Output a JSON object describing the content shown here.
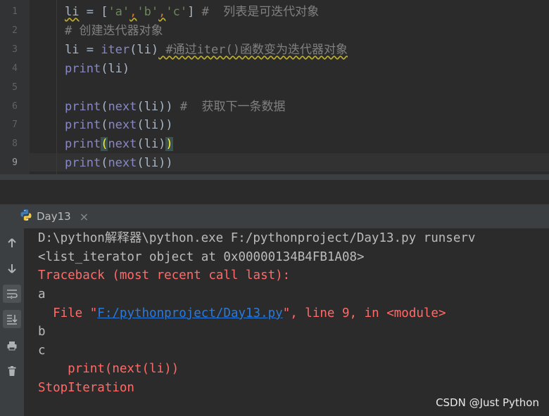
{
  "editor": {
    "line_numbers": [
      "1",
      "2",
      "3",
      "4",
      "5",
      "6",
      "7",
      "8",
      "9"
    ],
    "lines": {
      "l1": {
        "a": "li",
        "b": " = [",
        "s1": "'a'",
        "c1": ",",
        "s2": "'b'",
        "c2": ",",
        "s3": "'c'",
        "d": "]",
        "cmt": " #  列表是可迭代对象"
      },
      "l2": {
        "cmt": "# 创建迭代器对象"
      },
      "l3": {
        "a": "li = ",
        "fn": "iter",
        "b": "(li)",
        "cmt": " #通过iter()函数变为迭代器对象"
      },
      "l4": {
        "fn": "print",
        "b": "(li)"
      },
      "l6": {
        "fn": "print",
        "a": "(",
        "fn2": "next",
        "b": "(li))",
        "cmt": " #  获取下一条数据"
      },
      "l7": {
        "fn": "print",
        "a": "(",
        "fn2": "next",
        "b": "(li))"
      },
      "l8": {
        "fn": "print",
        "a": "(",
        "fn2": "next",
        "b": "(li)",
        "c": ")"
      },
      "l9": {
        "fn": "print",
        "a": "(",
        "fn2": "next",
        "b": "(li))"
      }
    }
  },
  "run_panel": {
    "tab_label": "Day13",
    "tab_close": "×"
  },
  "console": {
    "cmd": "D:\\python解释器\\python.exe F:/pythonproject/Day13.py runserv",
    "out1": "<list_iterator object at 0x00000134B4FB1A08>",
    "traceback": "Traceback (most recent call last):",
    "a": "a",
    "file_prefix": "  File \"",
    "file_link": "F:/pythonproject/Day13.py",
    "file_suffix": "\", line 9, in <module>",
    "b": "b",
    "c": "c",
    "src": "    print(next(li))",
    "stop": "StopIteration"
  },
  "watermark": "CSDN @Just Python"
}
